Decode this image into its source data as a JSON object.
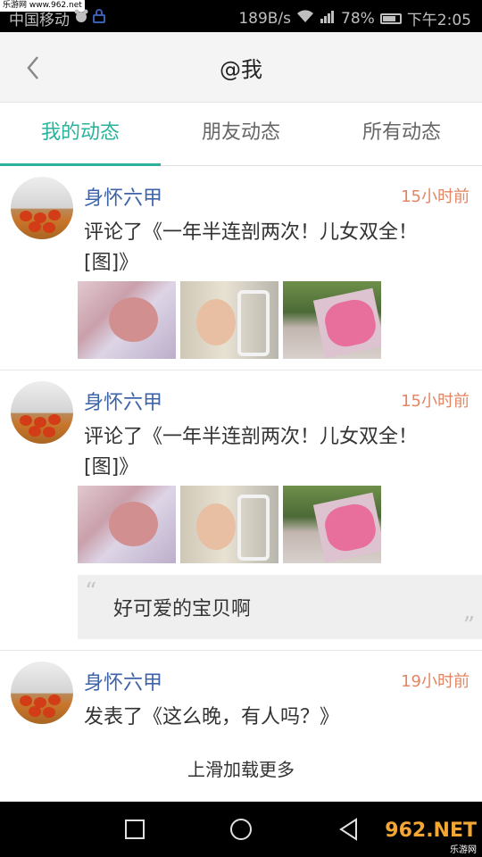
{
  "status_bar": {
    "watermark": "乐游网 www.962.net",
    "carrier": "中国移动",
    "speed": "189B/s",
    "battery": "78%",
    "time": "下午2:05",
    "color": "#000000"
  },
  "header": {
    "title": "@我",
    "back_icon": "chevron-left-icon"
  },
  "tabs": [
    {
      "label": "我的动态",
      "active": true
    },
    {
      "label": "朋友动态",
      "active": false
    },
    {
      "label": "所有动态",
      "active": false
    }
  ],
  "accent_color": "#2ab39a",
  "posts": [
    {
      "user": "身怀六甲",
      "time": "15小时前",
      "content": "评论了《一年半连剖两次！儿女双全！[图]》",
      "images": [
        "baby-sleeping",
        "baby-in-crib",
        "pink-flowers"
      ]
    },
    {
      "user": "身怀六甲",
      "time": "15小时前",
      "content": "评论了《一年半连剖两次！儿女双全！[图]》",
      "images": [
        "baby-sleeping",
        "baby-in-crib",
        "pink-flowers"
      ],
      "comment": "好可爱的宝贝啊"
    },
    {
      "user": "身怀六甲",
      "time": "19小时前",
      "content": "发表了《这么晚，有人吗？》"
    }
  ],
  "load_more": "上滑加载更多",
  "nav_watermark": {
    "logo": "962.NET",
    "sub": "乐游网"
  }
}
